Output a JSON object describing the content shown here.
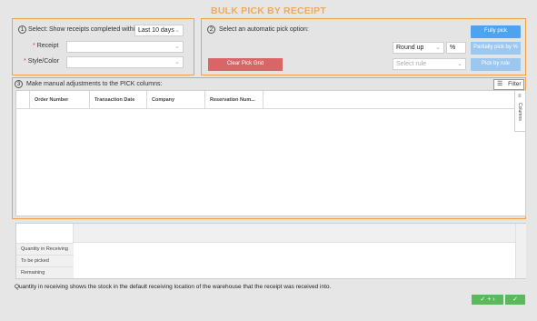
{
  "title": "BULK PICK BY RECEIPT",
  "step1": {
    "number": "1",
    "select_label": "Select:",
    "show_label": "Show receipts completed within",
    "period_value": "Last 10 days",
    "receipt_label": "Receipt",
    "style_color_label": "Style/Color",
    "required_mark": "*"
  },
  "step2": {
    "number": "2",
    "label": "Select an automatic pick option:",
    "fully_pick": "Fully pick",
    "partially_pick": "Partially pick by %",
    "pick_by_rule": "Pick by rule",
    "clear_pick_grid": "Clear Pick Grid",
    "round_value": "Round up",
    "percent_symbol": "%",
    "rule_placeholder": "Select rule",
    "colors": {
      "primary_blue": "#4da3f0",
      "light_blue": "#9cc8f0",
      "red": "#d96666"
    }
  },
  "step3": {
    "number": "3",
    "label": "Make manual adjustments to the PICK columns:",
    "filter_label": "Filter",
    "columns_tab": "Columns",
    "columns": [
      "Order Number",
      "Transaction Date",
      "Company",
      "Reservation Num..."
    ]
  },
  "bottom": {
    "rows": [
      "Quantity in Receiving",
      "To be picked",
      "Remaining"
    ]
  },
  "footer": {
    "note": "Quantity in receiving shows the stock in the default receiving location of the warehouse that the receipt was received into.",
    "check_plus_next": "✓ + ›",
    "check": "✓"
  }
}
